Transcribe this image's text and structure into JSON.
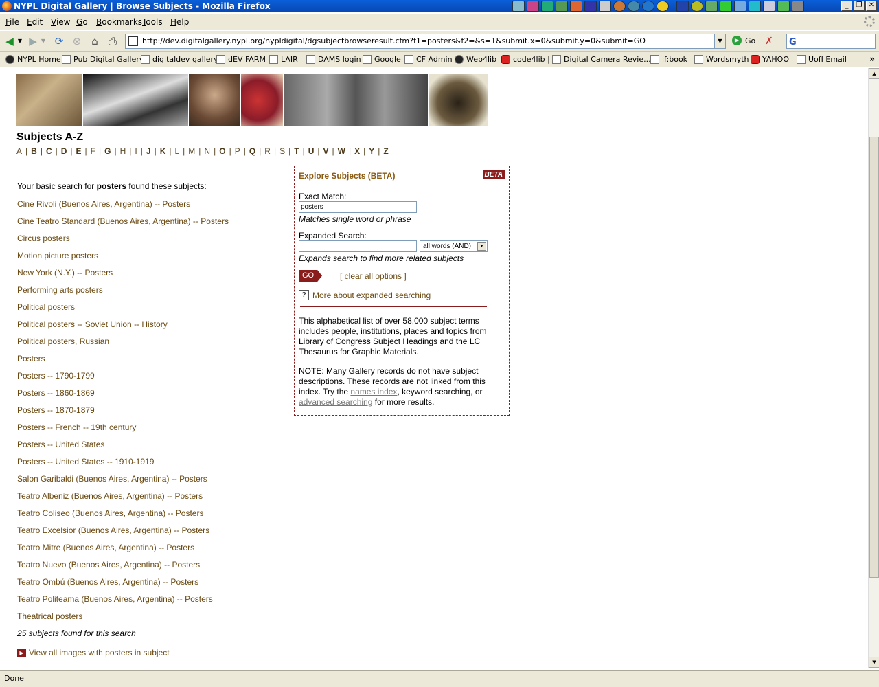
{
  "window": {
    "title": "NYPL Digital Gallery | Browse Subjects - Mozilla Firefox"
  },
  "menu": [
    "File",
    "Edit",
    "View",
    "Go",
    "Bookmarks",
    "Tools",
    "Help"
  ],
  "nav": {
    "url": "http://dev.digitalgallery.nypl.org/nypldigital/dgsubjectbrowseresult.cfm?f1=posters&f2=&s=1&submit.x=0&submit.y=0&submit=GO",
    "go_label": "Go"
  },
  "bookmarks": [
    "NYPL Home",
    "Pub Digital Gallery",
    "digitaldev gallery",
    "dEV FARM",
    "LAIR",
    "DAMS login",
    "Google",
    "CF Admin",
    "Web4lib",
    "code4lib |",
    "Digital Camera Revie...",
    "if:book",
    "Wordsmyth",
    "YAHOO",
    "UofI Email"
  ],
  "page": {
    "title": "Subjects A-Z",
    "letters": [
      "A",
      "B",
      "C",
      "D",
      "E",
      "F",
      "G",
      "H",
      "I",
      "J",
      "K",
      "L",
      "M",
      "N",
      "O",
      "P",
      "Q",
      "R",
      "S",
      "T",
      "U",
      "V",
      "W",
      "X",
      "Y",
      "Z"
    ],
    "results_intro_prefix": "Your basic search for",
    "results_term": "posters",
    "results_intro_suffix": "found these subjects:",
    "results": [
      "Cine Rivoli (Buenos Aires, Argentina) -- Posters",
      "Cine Teatro Standard (Buenos Aires, Argentina) -- Posters",
      "Circus posters",
      "Motion picture posters",
      "New York (N.Y.) -- Posters",
      "Performing arts posters",
      "Political posters",
      "Political posters -- Soviet Union -- History",
      "Political posters, Russian",
      "Posters",
      "Posters -- 1790-1799",
      "Posters -- 1860-1869",
      "Posters -- 1870-1879",
      "Posters -- French -- 19th century",
      "Posters -- United States",
      "Posters -- United States -- 1910-1919",
      "Salon Garibaldi (Buenos Aires, Argentina) -- Posters",
      "Teatro Albeniz (Buenos Aires, Argentina) -- Posters",
      "Teatro Coliseo (Buenos Aires, Argentina) -- Posters",
      "Teatro Excelsior (Buenos Aires, Argentina) -- Posters",
      "Teatro Mitre (Buenos Aires, Argentina) -- Posters",
      "Teatro Nuevo (Buenos Aires, Argentina) -- Posters",
      "Teatro Ombú (Buenos Aires, Argentina) -- Posters",
      "Teatro Politeama (Buenos Aires, Argentina) -- Posters",
      "Theatrical posters"
    ],
    "results_count": "25 subjects found for this search",
    "view_all": "View all images with posters in subject"
  },
  "explore": {
    "title": "Explore Subjects (BETA)",
    "beta": "BETA",
    "exact_label": "Exact Match:",
    "exact_value": "posters",
    "exact_hint": "Matches single word or phrase",
    "expanded_label": "Expanded Search:",
    "expanded_value": "",
    "mode_selected": "all words (AND)",
    "expanded_hint": "Expands search to find more related subjects",
    "go": "GO",
    "clear": "[ clear all options ]",
    "help": "More about expanded searching",
    "info": "This alphabetical list of over 58,000 subject terms includes people, institutions, places and topics from Library of Congress Subject Headings and the LC Thesaurus for Graphic Materials.",
    "note_prefix": "NOTE: Many Gallery records do not have subject descriptions. These records are not linked from this index. Try the",
    "note_link1": "names index",
    "note_mid": ", keyword searching, or",
    "note_link2": "advanced searching",
    "note_suffix": "for more results."
  },
  "status": "Done",
  "colors": {
    "link": "#6b4a12",
    "accent": "#8a1c1c",
    "titlebar": "#0a5fd8"
  }
}
